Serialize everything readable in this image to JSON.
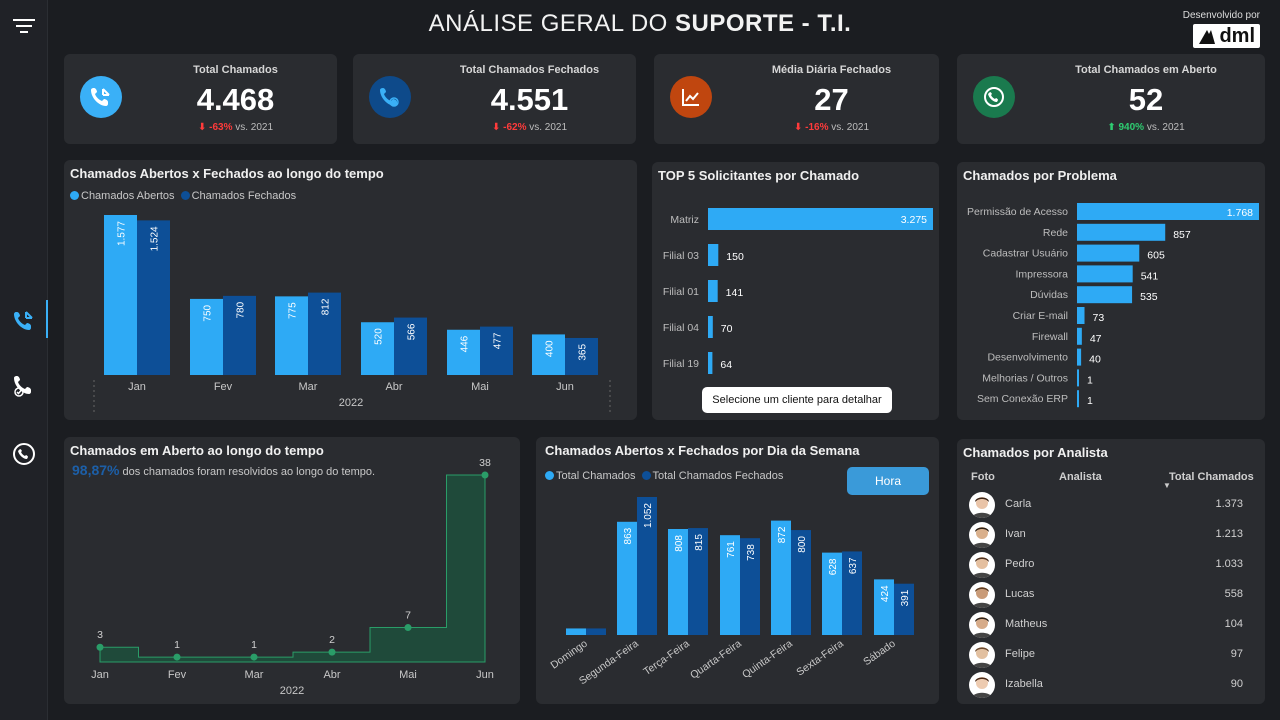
{
  "header": {
    "title_light": "ANÁLISE GERAL DO ",
    "title_bold": "SUPORTE - T.I.",
    "dev_by": "Desenvolvido por",
    "logo": "dml"
  },
  "kpis": [
    {
      "label": "Total Chamados",
      "value": "4.468",
      "delta": "-63%",
      "vs": "vs. 2021",
      "icon": "phone-incoming-icon",
      "color": "#3ab0f7",
      "trend": "down"
    },
    {
      "label": "Total Chamados Fechados",
      "value": "4.551",
      "delta": "-62%",
      "vs": "vs. 2021",
      "icon": "phone-check-icon",
      "color": "#0e4a8a",
      "trend": "down"
    },
    {
      "label": "Média Diária Fechados",
      "value": "27",
      "delta": "-16%",
      "vs": "vs. 2021",
      "icon": "trend-chart-icon",
      "color": "#c0460f",
      "trend": "down"
    },
    {
      "label": "Total Chamados em Aberto",
      "value": "52",
      "delta": "940%",
      "vs": "vs. 2021",
      "icon": "phone-clock-icon",
      "color": "#1a7a4e",
      "trend": "up"
    }
  ],
  "colors": {
    "light": "#2eaaf5",
    "dark": "#0d4f97",
    "green": "#2a9d68"
  },
  "panel1": {
    "title": "Chamados Abertos x Fechados ao longo do tempo",
    "legend": [
      "Chamados Abertos",
      "Chamados Fechados"
    ],
    "year": "2022"
  },
  "panel2": {
    "title": "TOP 5 Solicitantes por Chamado",
    "button": "Selecione um cliente para detalhar"
  },
  "panel3": {
    "title": "Chamados por Problema"
  },
  "panel4": {
    "title": "Chamados em Aberto ao longo do tempo",
    "highlight": "98,87%",
    "subtitle": " dos chamados foram resolvidos ao longo do tempo.",
    "year": "2022"
  },
  "panel5": {
    "title": "Chamados Abertos x Fechados por Dia da Semana",
    "legend": [
      "Total Chamados",
      "Total Chamados Fechados"
    ],
    "button": "Hora"
  },
  "panel6": {
    "title": "Chamados por Analista",
    "col_foto": "Foto",
    "col_analista": "Analista",
    "col_total": "Total Chamados",
    "rows": [
      {
        "name": "Carla",
        "value": "1.373"
      },
      {
        "name": "Ivan",
        "value": "1.213"
      },
      {
        "name": "Pedro",
        "value": "1.033"
      },
      {
        "name": "Lucas",
        "value": "558"
      },
      {
        "name": "Matheus",
        "value": "104"
      },
      {
        "name": "Felipe",
        "value": "97"
      },
      {
        "name": "Izabella",
        "value": "90"
      }
    ]
  },
  "chart_data": [
    {
      "type": "bar",
      "categories": [
        "Jan",
        "Fev",
        "Mar",
        "Abr",
        "Mai",
        "Jun"
      ],
      "series": [
        {
          "name": "Chamados Abertos",
          "values": [
            1577,
            750,
            775,
            520,
            446,
            400
          ]
        },
        {
          "name": "Chamados Fechados",
          "values": [
            1524,
            780,
            812,
            566,
            477,
            365
          ]
        }
      ],
      "labels": [
        [
          "1.577",
          "750",
          "775",
          "520",
          "446",
          "400"
        ],
        [
          "1.524",
          "780",
          "812",
          "566",
          "477",
          "365"
        ]
      ]
    },
    {
      "type": "bar",
      "orientation": "horizontal",
      "categories": [
        "Matriz",
        "Filial 03",
        "Filial 01",
        "Filial 04",
        "Filial 19"
      ],
      "values": [
        3275,
        150,
        141,
        70,
        64
      ],
      "labels": [
        "3.275",
        "150",
        "141",
        "70",
        "64"
      ]
    },
    {
      "type": "bar",
      "orientation": "horizontal",
      "categories": [
        "Permissão de Acesso",
        "Rede",
        "Cadastrar Usuário",
        "Impressora",
        "Dúvidas",
        "Criar E-mail",
        "Firewall",
        "Desenvolvimento",
        "Melhorias / Outros",
        "Sem Conexão ERP"
      ],
      "values": [
        1768,
        857,
        605,
        541,
        535,
        73,
        47,
        40,
        1,
        1
      ],
      "labels": [
        "1.768",
        "857",
        "605",
        "541",
        "535",
        "73",
        "47",
        "40",
        "1",
        "1"
      ]
    },
    {
      "type": "area",
      "categories": [
        "Jan",
        "Fev",
        "Mar",
        "Abr",
        "Mai",
        "Jun"
      ],
      "values": [
        3,
        1,
        1,
        2,
        7,
        38
      ]
    },
    {
      "type": "bar",
      "categories": [
        "Domingo",
        "Segunda-Feira",
        "Terça-Feira",
        "Quarta-Feira",
        "Quinta-Feira",
        "Sexta-Feira",
        "Sábado"
      ],
      "series": [
        {
          "name": "Total Chamados",
          "values": [
            50,
            863,
            808,
            761,
            872,
            628,
            424
          ]
        },
        {
          "name": "Total Chamados Fechados",
          "values": [
            50,
            1052,
            815,
            738,
            800,
            637,
            391
          ]
        }
      ],
      "labels": [
        [
          "",
          "863",
          "808",
          "761",
          "872",
          "628",
          "424"
        ],
        [
          "",
          "1.052",
          "815",
          "738",
          "800",
          "637",
          "391"
        ]
      ]
    }
  ]
}
